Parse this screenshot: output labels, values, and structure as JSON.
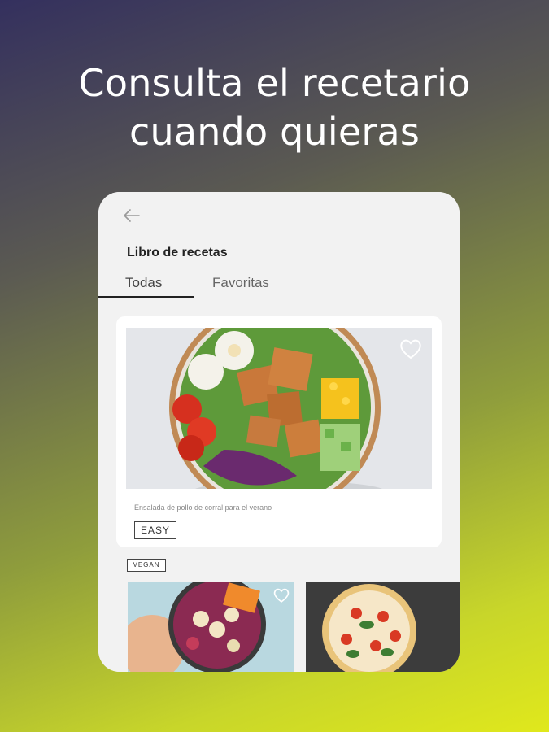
{
  "headline": {
    "line1": "Consulta el recetario",
    "line2": "cuando quieras"
  },
  "app": {
    "page_title": "Libro de recetas",
    "tabs": [
      {
        "label": "Todas",
        "active": true
      },
      {
        "label": "Favoritas",
        "active": false
      }
    ],
    "featured_recipe": {
      "caption": "Ensalada de pollo de corral para el verano",
      "difficulty_badge": "EASY"
    },
    "vegan_badge": "VEGAN"
  },
  "colors": {
    "gradient_start": "#34305e",
    "gradient_end": "#e0e81c",
    "card_bg": "#ffffff",
    "app_bg": "#f2f2f2"
  },
  "icons": [
    "back-arrow-icon",
    "heart-outline-icon"
  ]
}
